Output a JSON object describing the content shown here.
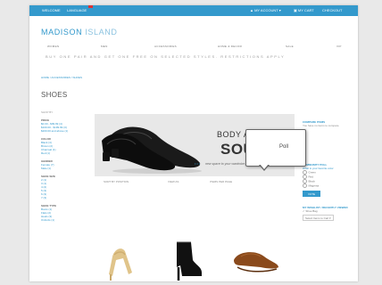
{
  "topbar": {
    "welcome": "WELCOME",
    "language": "LANGUAGE",
    "account": "MY ACCOUNT",
    "cart": "MY CART",
    "checkout": "CHECKOUT"
  },
  "header": {
    "logo_bold": "MADISON",
    "logo_light": "ISLAND"
  },
  "nav": {
    "items": [
      "WOMEN",
      "MEN",
      "ACCESSORIES",
      "HOME & DECOR",
      "SALE",
      "VIP"
    ]
  },
  "promo_text": "BUY ONE PAIR AND GET ONE FREE ON SELECTED STYLES. RESTRICTIONS APPLY",
  "breadcrumb": "HOME / ACCESSORIES / SHOES",
  "page_title": "SHOES",
  "filters": {
    "shop_by": "SHOP BY",
    "groups": [
      {
        "title": "PRICE",
        "items": [
          "$0.00 - $99.99 (4)",
          "$100.00 - $199.99 (3)",
          "$200.00 and above (1)"
        ]
      },
      {
        "title": "COLOR",
        "items": [
          "Black (4)",
          "Brown (2)",
          "Charcoal (1)",
          "Red (1)"
        ]
      },
      {
        "title": "GENDER",
        "items": [
          "Female (7)",
          "Male (1)"
        ]
      },
      {
        "title": "SHOE SIZE",
        "items": [
          "2 (1)",
          "3 (1)",
          "4 (2)",
          "5 (3)",
          "6 (3)",
          "7 (3)"
        ]
      },
      {
        "title": "SHOE TYPE",
        "items": [
          "Boots (1)",
          "Flats (2)",
          "Heels (3)",
          "Oxfords (1)"
        ]
      }
    ]
  },
  "banner": {
    "heading_small": "BODY AND",
    "heading_large": "SOUL",
    "subtext": "new space to your wardrobe, these work to play instant hits",
    "dots": "•••"
  },
  "poll_popup": {
    "title": "Poll"
  },
  "toolbar": {
    "sort_label": "SORT BY   POSITION",
    "view_label": "VIEW AS",
    "items_label": "ITEMS PER PAGE"
  },
  "right_sidebar": {
    "compare_title": "COMPARE ITEMS",
    "compare_text": "You have no items to compare.",
    "poll_title": "COMMUNITY POLL",
    "poll_question": "What is your favorite color",
    "poll_options": [
      "Green",
      "Red",
      "Black",
      "Magenta"
    ],
    "vote_button": "VOTE",
    "recent_title": "MY WISHLIST / RECENTLY VIEWED",
    "recent_item": "Shoe Bag",
    "select_value": "Select Items to Cart"
  },
  "colors": {
    "accent": "#3399cc",
    "background": "#e9e9e9",
    "banner_bg": "#e8e8e8"
  }
}
